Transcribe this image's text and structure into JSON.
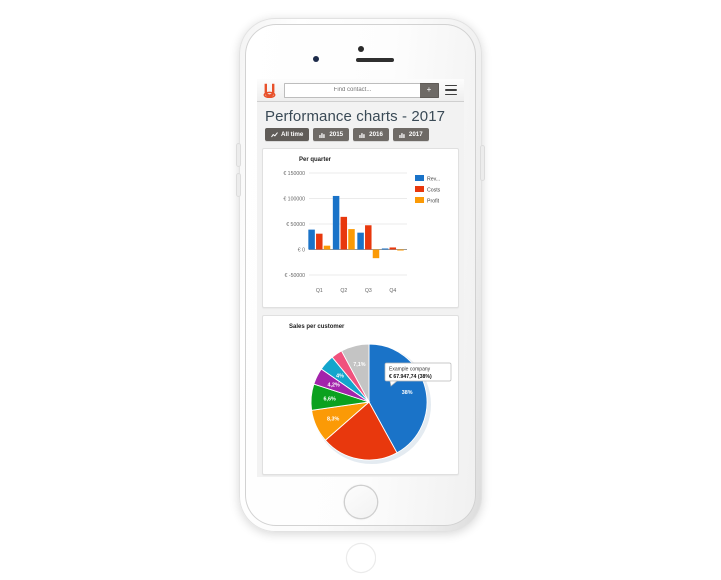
{
  "app": {
    "logo_name": "unity-u-logo",
    "logo_color": "#e8502a"
  },
  "topbar": {
    "search_placeholder": "Find contact...",
    "search_value": "",
    "add_label": "+",
    "menu_label": "menu"
  },
  "page": {
    "title": "Performance charts - 2017",
    "tabs": [
      {
        "label": "All time",
        "icon": "line-chart-icon",
        "active": true
      },
      {
        "label": "2015",
        "icon": "bar-chart-icon",
        "active": false
      },
      {
        "label": "2016",
        "icon": "bar-chart-icon",
        "active": false
      },
      {
        "label": "2017",
        "icon": "bar-chart-icon",
        "active": false
      }
    ]
  },
  "chart_data": [
    {
      "type": "bar",
      "title": "Per quarter",
      "categories": [
        "Q1",
        "Q2",
        "Q3",
        "Q4"
      ],
      "series": [
        {
          "name": "Rev...",
          "color": "#1a73c8",
          "values": [
            39000,
            105000,
            33000,
            2000
          ]
        },
        {
          "name": "Costs",
          "color": "#e8380d",
          "values": [
            31000,
            64000,
            47500,
            4000
          ]
        },
        {
          "name": "Profit",
          "color": "#fb9a06",
          "values": [
            7500,
            40000,
            -17000,
            -2000
          ]
        }
      ],
      "xlabel": "",
      "ylabel": "",
      "ylim": [
        -50000,
        150000
      ],
      "ytick_labels": [
        "€ 150000",
        "€ 100000",
        "€ 50000",
        "€ 0",
        "€ -50000"
      ],
      "ytick_values": [
        150000,
        100000,
        50000,
        0,
        -50000
      ],
      "grid": true,
      "legend_position": "right"
    },
    {
      "type": "pie",
      "title": "Sales per customer",
      "labels": [
        "38%",
        "",
        "8,3%",
        "6,6%",
        "4,2%",
        "4%",
        "",
        "7,1%"
      ],
      "values": [
        38,
        19.5,
        8.3,
        6.6,
        4.2,
        4,
        2.8,
        7.1
      ],
      "colors": [
        "#1a73c8",
        "#e8380d",
        "#fb9a06",
        "#0ba11f",
        "#a324ab",
        "#13a5cc",
        "#f0527d",
        "#c4c4c4"
      ],
      "tooltip": {
        "name": "Example company",
        "value": "€ 67.947,74 (38%)"
      }
    }
  ]
}
